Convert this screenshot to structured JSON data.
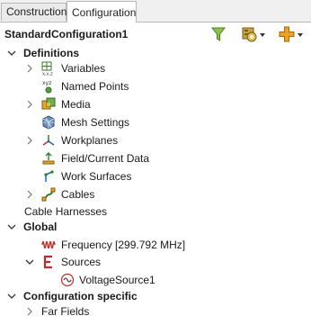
{
  "tabs": [
    {
      "label": "Construction",
      "active": false
    },
    {
      "label": "Configuration",
      "active": true
    }
  ],
  "header": {
    "title": "StandardConfiguration1",
    "buttons": [
      "filter-icon",
      "config-settings-icon",
      "add-icon"
    ]
  },
  "tree": {
    "definitions": {
      "label": "Definitions",
      "items": [
        {
          "label": "Variables",
          "icon": "variables-icon",
          "expandable": true
        },
        {
          "label": "Named Points",
          "icon": "named-points-icon",
          "expandable": false
        },
        {
          "label": "Media",
          "icon": "media-icon",
          "expandable": true
        },
        {
          "label": "Mesh Settings",
          "icon": "mesh-settings-icon",
          "expandable": false
        },
        {
          "label": "Workplanes",
          "icon": "workplanes-icon",
          "expandable": true
        },
        {
          "label": "Field/Current Data",
          "icon": "field-data-icon",
          "expandable": false
        },
        {
          "label": "Work Surfaces",
          "icon": "work-surfaces-icon",
          "expandable": false
        },
        {
          "label": "Cables",
          "icon": "cables-icon",
          "expandable": true
        }
      ]
    },
    "cable_harnesses": {
      "label": "Cable Harnesses"
    },
    "global": {
      "label": "Global",
      "frequency": {
        "label": "Frequency [299.792 MHz]"
      },
      "sources": {
        "label": "Sources",
        "children": [
          {
            "label": "VoltageSource1"
          }
        ]
      }
    },
    "configuration_specific": {
      "label": "Configuration specific",
      "items": [
        {
          "label": "Far Fields",
          "expandable": true
        }
      ]
    }
  },
  "colors": {
    "accent_green": "#8bc34a",
    "source_red": "#c62828",
    "add_orange": "#f0a020"
  }
}
